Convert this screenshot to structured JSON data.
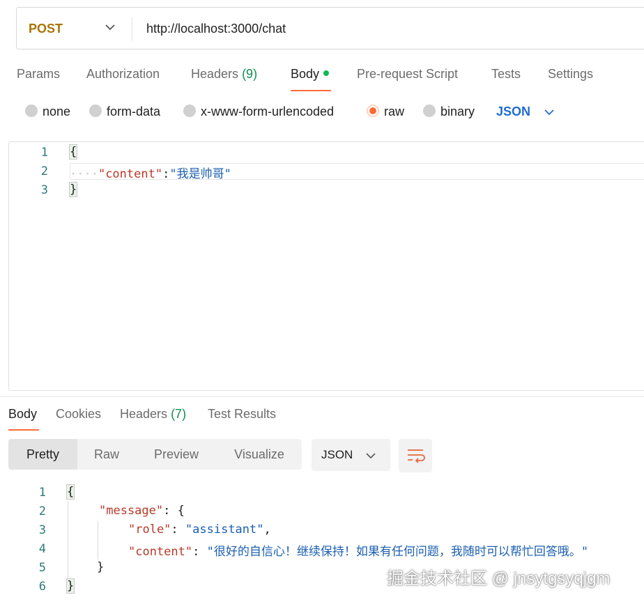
{
  "request": {
    "method": "POST",
    "url": "http://localhost:3000/chat"
  },
  "request_tabs": {
    "params": "Params",
    "authorization": "Authorization",
    "headers": "Headers",
    "headers_count": "(9)",
    "body": "Body",
    "prerequest": "Pre-request Script",
    "tests": "Tests",
    "settings": "Settings"
  },
  "body_types": {
    "none": "none",
    "form_data": "form-data",
    "urlencoded": "x-www-form-urlencoded",
    "raw": "raw",
    "binary": "binary",
    "format": "JSON",
    "selected": "raw"
  },
  "request_editor": {
    "line_numbers": [
      "1",
      "2",
      "3"
    ],
    "open_brace": "{",
    "indent": "····",
    "key": "\"content\"",
    "colon": ":",
    "value": "\"我是帅哥\"",
    "close_brace": "}"
  },
  "response_tabs": {
    "body": "Body",
    "cookies": "Cookies",
    "headers": "Headers",
    "headers_count": "(7)",
    "test_results": "Test Results"
  },
  "view_modes": {
    "pretty": "Pretty",
    "raw": "Raw",
    "preview": "Preview",
    "visualize": "Visualize",
    "selected": "Pretty"
  },
  "response_format": "JSON",
  "response_body": {
    "line_numbers": [
      "1",
      "2",
      "3",
      "4",
      "5",
      "6"
    ],
    "open_brace": "{",
    "message_key": "\"message\"",
    "message_open": ": {",
    "role_key": "\"role\"",
    "role_colon": ": ",
    "role_value": "\"assistant\"",
    "role_comma": ",",
    "content_key": "\"content\"",
    "content_colon": ": ",
    "content_value": "\"很好的自信心！继续保持！如果有任何问题，我随时可以帮忙回答哦。\"",
    "inner_close": "}",
    "close_brace": "}"
  },
  "watermark": "掘金技术社区 @ jnsytgsyqjgm",
  "colors": {
    "accent": "#ff6c37",
    "method": "#a87406",
    "count": "#0f8f4d",
    "json_select": "#1f6bd1",
    "string_key": "#b73a28",
    "string_value": "#1b5fb0",
    "line_number": "#2b7a78"
  }
}
